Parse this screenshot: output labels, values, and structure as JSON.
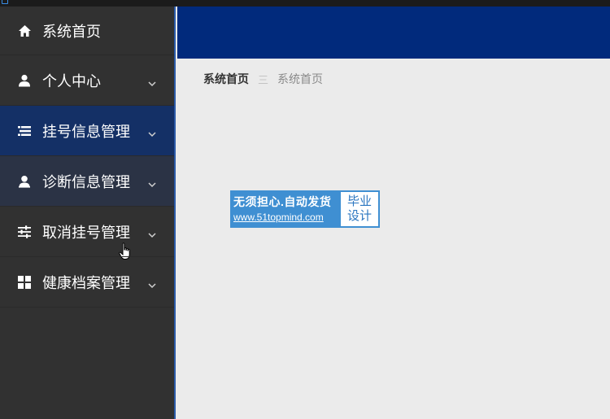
{
  "sidebar": {
    "items": [
      {
        "label": "系统首页",
        "icon": "home-icon"
      },
      {
        "label": "个人中心",
        "icon": "user-icon"
      },
      {
        "label": "挂号信息管理",
        "icon": "list-icon"
      },
      {
        "label": "诊断信息管理",
        "icon": "person-icon"
      },
      {
        "label": "取消挂号管理",
        "icon": "sliders-icon"
      },
      {
        "label": "健康档案管理",
        "icon": "grid-icon"
      }
    ]
  },
  "breadcrumb": {
    "home": "系统首页",
    "separator": "三",
    "current": "系统首页"
  },
  "banner": {
    "line1": "无须担心.自动发货",
    "line2": "www.51topmind.com",
    "badge_line1": "毕业",
    "badge_line2": "设计"
  },
  "colors": {
    "header": "#012a7c",
    "sidebar": "#313131",
    "active_item": "#143066",
    "content_bg": "#ebebeb"
  }
}
